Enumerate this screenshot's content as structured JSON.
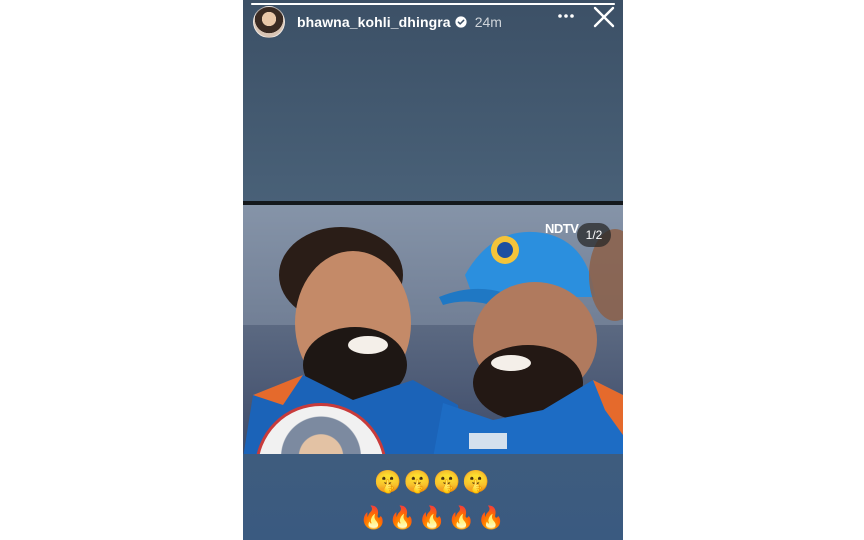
{
  "story": {
    "username": "bhawna_kohli_dhingra",
    "time_ago": "24m",
    "progress_fraction": 1.0,
    "page_counter": "1/2",
    "watermark": "NDTV",
    "caption_line1": "🤫🤫🤫🤫",
    "caption_line2": "🔥🔥🔥🔥🔥"
  },
  "icons": {
    "verified": "verified-badge-icon",
    "more": "more-options-icon",
    "close": "close-icon"
  },
  "colors": {
    "story_bg": "#3c5066",
    "verified_badge": "#ffffff",
    "inset_ring": "#c83b3b"
  }
}
